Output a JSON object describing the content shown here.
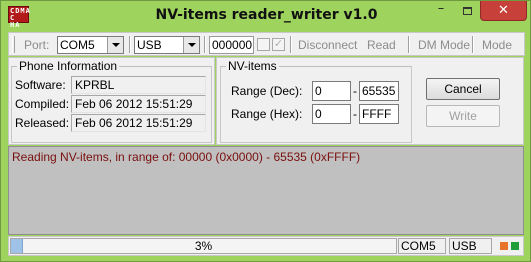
{
  "window": {
    "title": "NV-items reader_writer v1.0",
    "icon_text": [
      "CDMA",
      "C HA"
    ],
    "buttons": {
      "minimize": "–",
      "close": "✕"
    }
  },
  "toolbar": {
    "port_label": "Port:",
    "port_value": "COM5",
    "connection_value": "USB",
    "code_value": "000000",
    "disconnect_label": "Disconnect",
    "read_label": "Read",
    "dm_mode_label": "DM Mode",
    "mode_label": "Mode"
  },
  "phone_info": {
    "title": "Phone Information",
    "rows": [
      {
        "label": "Software:",
        "value": "KPRBL"
      },
      {
        "label": "Compiled:",
        "value": "Feb 06 2012 15:51:29"
      },
      {
        "label": "Released:",
        "value": "Feb 06 2012 15:51:29"
      }
    ]
  },
  "nv_items": {
    "title": "NV-items",
    "range_dec_label": "Range (Dec):",
    "range_dec_from": "0",
    "range_dec_to": "65535",
    "range_hex_label": "Range (Hex):",
    "range_hex_from": "0",
    "range_hex_to": "FFFF",
    "separator": "-",
    "cancel_label": "Cancel",
    "write_label": "Write"
  },
  "log": {
    "line": "Reading NV-items, in range of:  00000 (0x0000) - 65535 (0xFFFF)"
  },
  "status_bar": {
    "progress_percent": 3,
    "progress_text": "3%",
    "port": "COM5",
    "connection": "USB",
    "colors": {
      "led_orange": "#e8742a",
      "led_green": "#1f9e3a",
      "progress_fill": "#9fc3e8"
    }
  }
}
